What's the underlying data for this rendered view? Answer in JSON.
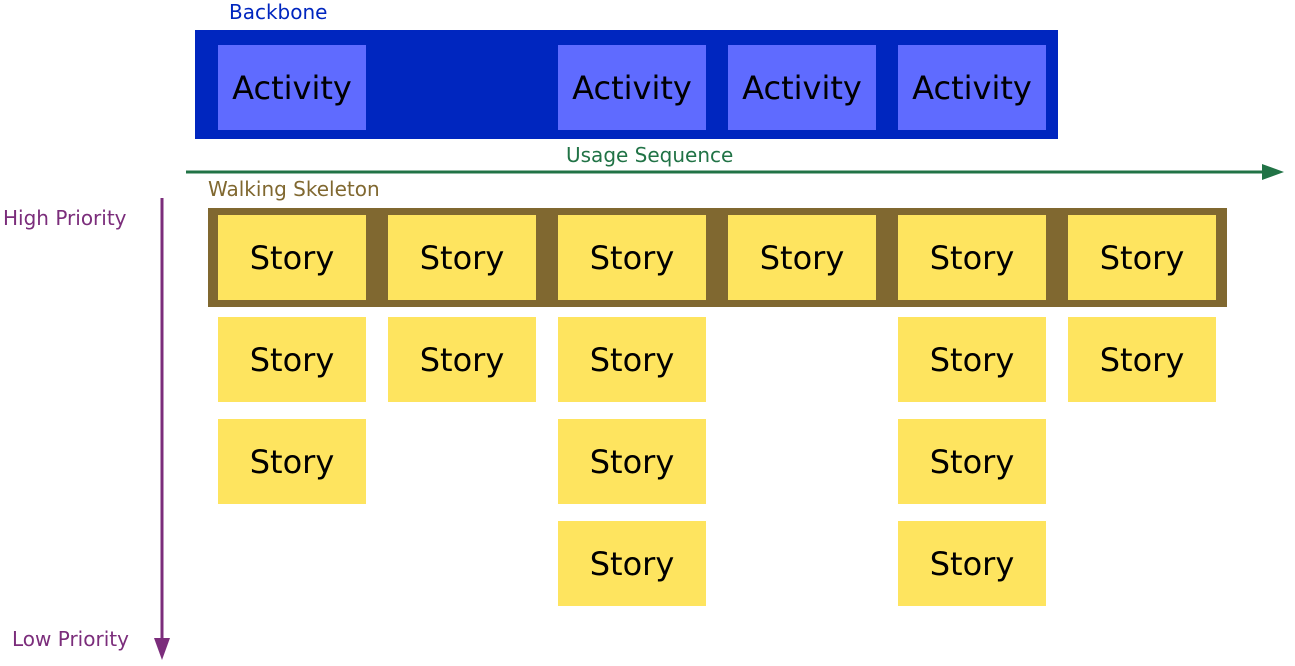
{
  "backbone": {
    "label": "Backbone",
    "activities": [
      {
        "label": "Activity",
        "column": 0
      },
      {
        "label": "Activity",
        "column": 2
      },
      {
        "label": "Activity",
        "column": 3
      },
      {
        "label": "Activity",
        "column": 4
      }
    ]
  },
  "usage_sequence": {
    "label": "Usage Sequence"
  },
  "walking_skeleton": {
    "label": "Walking Skeleton"
  },
  "priority": {
    "high_label": "High Priority",
    "low_label": "Low Priority"
  },
  "stories": {
    "label": "Story",
    "columns": [
      {
        "count": 3
      },
      {
        "count": 2
      },
      {
        "count": 4
      },
      {
        "count": 1
      },
      {
        "count": 4
      },
      {
        "count": 2
      }
    ]
  },
  "colors": {
    "backbone": "#0026bf",
    "activity": "#5f6bff",
    "walking_skeleton": "#806830",
    "story": "#fee45f",
    "usage_arrow": "#217346",
    "priority_arrow": "#7b2d7b"
  }
}
